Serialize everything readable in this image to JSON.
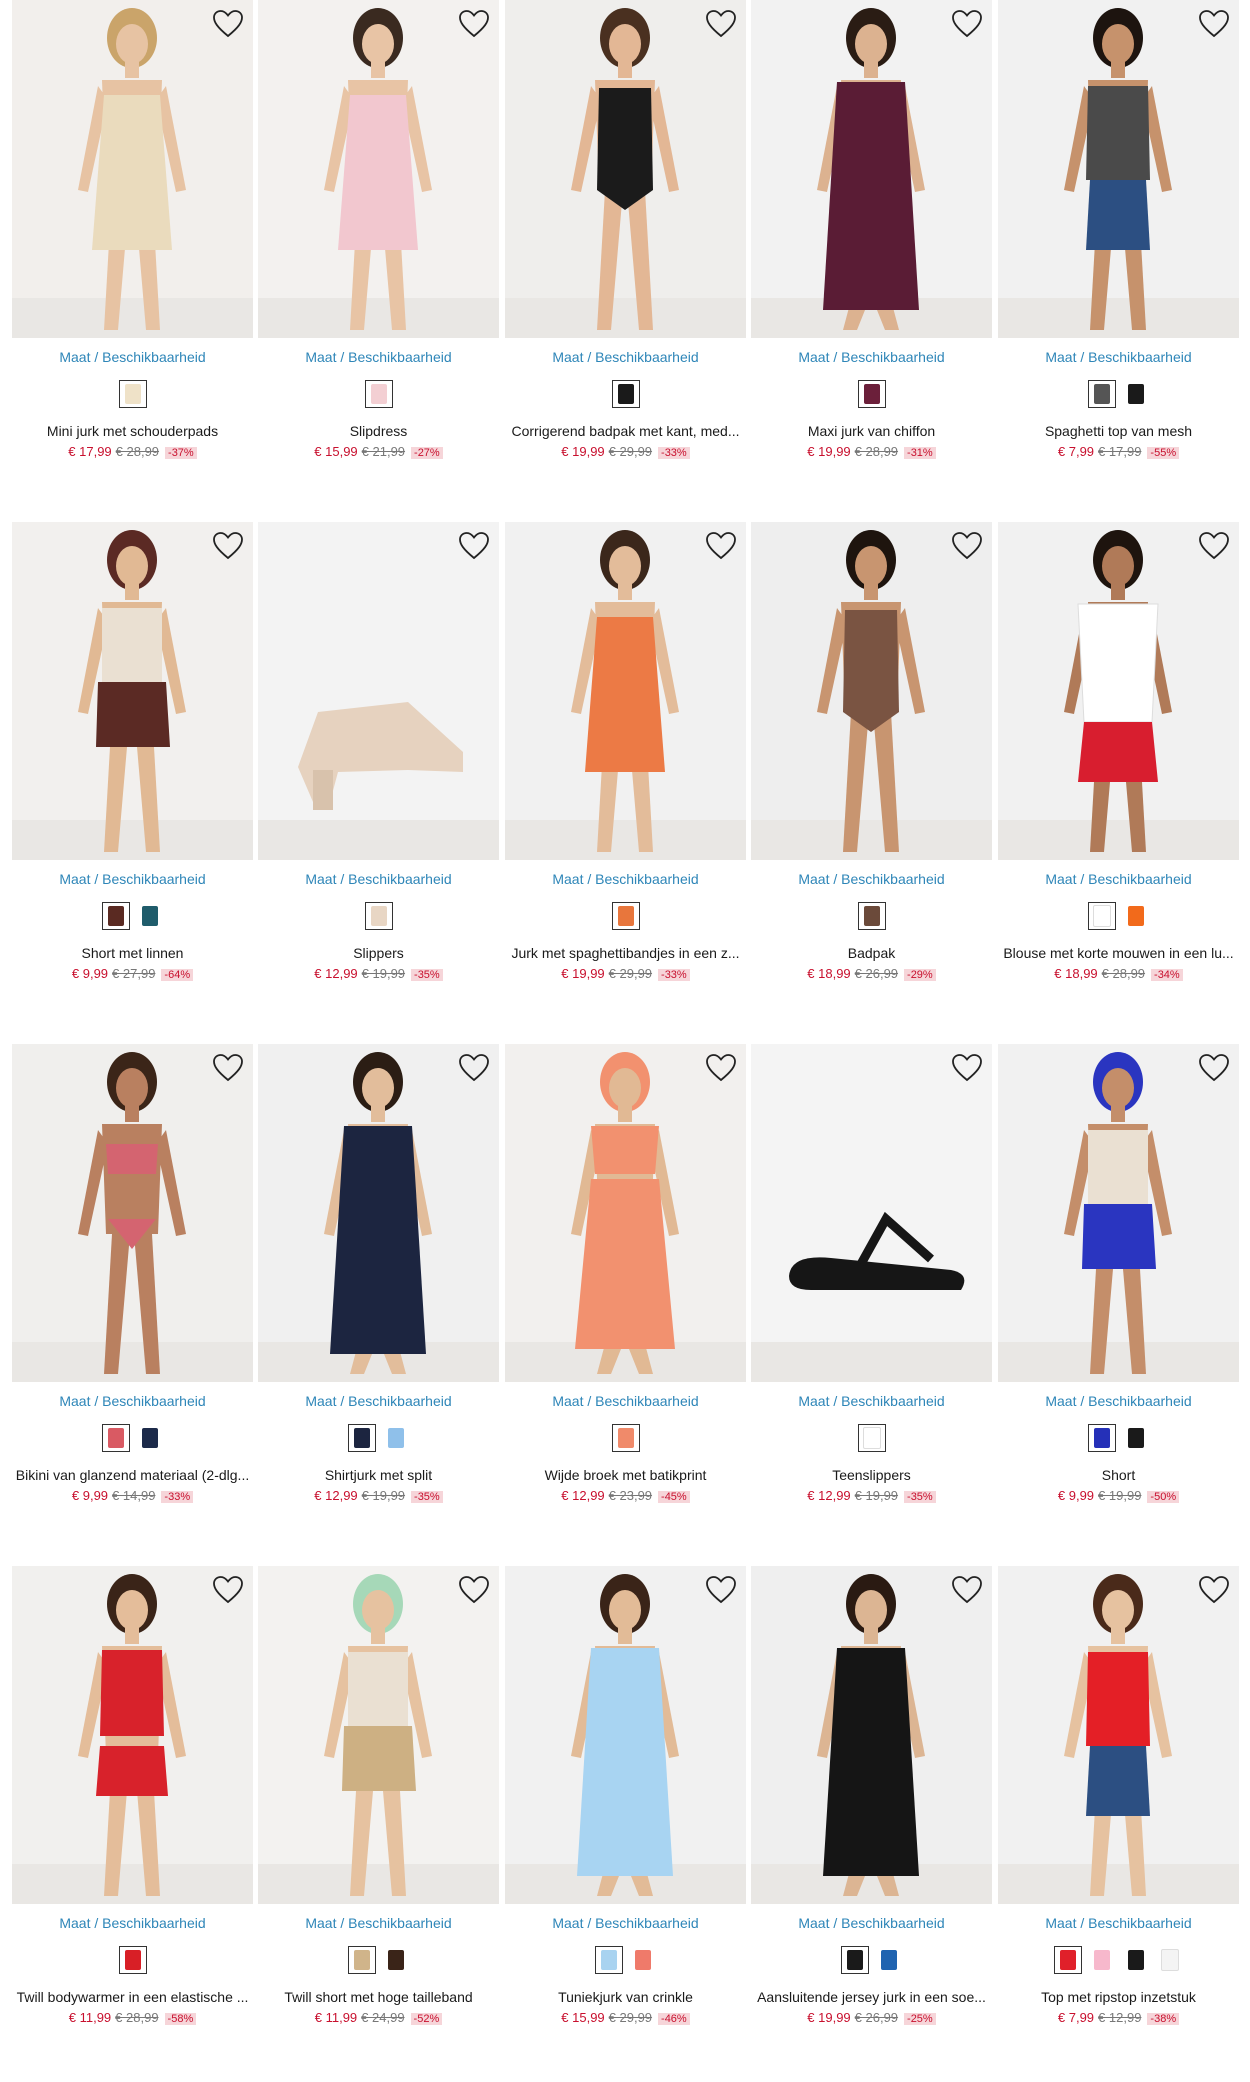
{
  "availability_label": "Maat / Beschikbaarheid",
  "colors": {
    "link": "#2e86b8",
    "sale": "#c8102e",
    "discount_bg": "#f6d5d9",
    "old_price": "#777777"
  },
  "wishlist_icon": "heart-outline-icon",
  "products": [
    {
      "title": "Mini jurk met schouderpads",
      "price": "€ 17,99",
      "old_price": "€ 28,99",
      "discount": "-37%",
      "swatches": [
        "#efe2c8"
      ],
      "image": {
        "bg": "#f2efec",
        "garment": "#eadbbd",
        "kind": "dress",
        "skin": "#e7c3a3",
        "hair": "#caa46a"
      }
    },
    {
      "title": "Slipdress",
      "price": "€ 15,99",
      "old_price": "€ 21,99",
      "discount": "-27%",
      "swatches": [
        "#f3cfd3"
      ],
      "image": {
        "bg": "#f3f1ef",
        "garment": "#f2c7cf",
        "kind": "dress",
        "skin": "#e8c4a5",
        "hair": "#3a2a20"
      }
    },
    {
      "title": "Corrigerend badpak met kant, med...",
      "price": "€ 19,99",
      "old_price": "€ 29,99",
      "discount": "-33%",
      "swatches": [
        "#1a1a1a"
      ],
      "image": {
        "bg": "#efeeec",
        "garment": "#1b1b1b",
        "kind": "swim",
        "skin": "#e3b795",
        "hair": "#4a3020"
      }
    },
    {
      "title": "Maxi jurk van chiffon",
      "price": "€ 19,99",
      "old_price": "€ 28,99",
      "discount": "-31%",
      "swatches": [
        "#6b1f3a"
      ],
      "image": {
        "bg": "#f2f2f2",
        "garment": "#5a1c35",
        "kind": "maxi",
        "skin": "#dcb290",
        "hair": "#2a1c14"
      }
    },
    {
      "title": "Spaghetti top van mesh",
      "price": "€ 7,99",
      "old_price": "€ 17,99",
      "discount": "-55%",
      "swatches": [
        "#555555",
        "#1a1a1a"
      ],
      "image": {
        "bg": "#f1f1f1",
        "garment": "#4a4a4a",
        "kind": "top",
        "skin": "#c6926c",
        "hair": "#1d140f"
      }
    },
    {
      "title": "Short met linnen",
      "price": "€ 9,99",
      "old_price": "€ 27,99",
      "discount": "-64%",
      "swatches": [
        "#5a2a22",
        "#1f5c6b"
      ],
      "image": {
        "bg": "#f2f0ee",
        "garment": "#5b2a24",
        "kind": "shorts",
        "skin": "#e1b994",
        "hair": "#5b2a24"
      }
    },
    {
      "title": "Slippers",
      "price": "€ 12,99",
      "old_price": "€ 19,99",
      "discount": "-35%",
      "swatches": [
        "#e8d6c4"
      ],
      "image": {
        "bg": "#f3f3f3",
        "garment": "#e6d2bf",
        "kind": "heel",
        "skin": "#e6d2bf",
        "hair": "#e6d2bf"
      }
    },
    {
      "title": "Jurk met spaghettibandjes in een z...",
      "price": "€ 19,99",
      "old_price": "€ 29,99",
      "discount": "-33%",
      "swatches": [
        "#e8763c"
      ],
      "image": {
        "bg": "#f1f1f1",
        "garment": "#ec7a45",
        "kind": "dress",
        "skin": "#e3bc9a",
        "hair": "#3b271b"
      }
    },
    {
      "title": "Badpak",
      "price": "€ 18,99",
      "old_price": "€ 26,99",
      "discount": "-29%",
      "swatches": [
        "#6b4a3a"
      ],
      "image": {
        "bg": "#eeeeee",
        "garment": "#7a5442",
        "kind": "swim",
        "skin": "#c89570",
        "hair": "#1e140e"
      }
    },
    {
      "title": "Blouse met korte mouwen in een lu...",
      "price": "€ 18,99",
      "old_price": "€ 28,99",
      "discount": "-34%",
      "swatches": [
        "#ffffff",
        "#f26a1b"
      ],
      "image": {
        "bg": "#f1f1f1",
        "garment": "#ffffff",
        "kind": "blouse",
        "skin": "#b07a58",
        "hair": "#1e140e"
      }
    },
    {
      "title": "Bikini van glanzend materiaal (2-dlg...",
      "price": "€ 9,99",
      "old_price": "€ 14,99",
      "discount": "-33%",
      "swatches": [
        "#d95a63",
        "#1c2a4a"
      ],
      "image": {
        "bg": "#f0efed",
        "garment": "#d46470",
        "kind": "bikini",
        "skin": "#b98060",
        "hair": "#3b2518"
      }
    },
    {
      "title": "Shirtjurk met split",
      "price": "€ 12,99",
      "old_price": "€ 19,99",
      "discount": "-35%",
      "swatches": [
        "#1c2540",
        "#8fc0ea"
      ],
      "image": {
        "bg": "#f0f0f0",
        "garment": "#1c2540",
        "kind": "maxi",
        "skin": "#e2bd9b",
        "hair": "#2b1d14"
      }
    },
    {
      "title": "Wijde broek met batikprint",
      "price": "€ 12,99",
      "old_price": "€ 23,99",
      "discount": "-45%",
      "swatches": [
        "#f08a6a"
      ],
      "image": {
        "bg": "#f2f0ee",
        "garment": "#f2916f",
        "kind": "pants",
        "skin": "#e1b994",
        "hair": "#f2916f"
      }
    },
    {
      "title": "Teenslippers",
      "price": "€ 12,99",
      "old_price": "€ 19,99",
      "discount": "-35%",
      "swatches": [
        "#ffffff"
      ],
      "image": {
        "bg": "#f4f4f4",
        "garment": "#161616",
        "kind": "sandal",
        "skin": "#161616",
        "hair": "#161616"
      }
    },
    {
      "title": "Short",
      "price": "€ 9,99",
      "old_price": "€ 19,99",
      "discount": "-50%",
      "swatches": [
        "#2530b8",
        "#1a1a1a"
      ],
      "image": {
        "bg": "#f1f1f1",
        "garment": "#2a35c0",
        "kind": "shorts",
        "skin": "#c48e6a",
        "hair": "#2a35c0"
      }
    },
    {
      "title": "Twill bodywarmer in een elastische ...",
      "price": "€ 11,99",
      "old_price": "€ 28,99",
      "discount": "-58%",
      "swatches": [
        "#d81f26"
      ],
      "image": {
        "bg": "#f1f0ee",
        "garment": "#d8222b",
        "kind": "vest",
        "skin": "#e4bd9a",
        "hair": "#3a2418"
      }
    },
    {
      "title": "Twill short met hoge tailleband",
      "price": "€ 11,99",
      "old_price": "€ 24,99",
      "discount": "-52%",
      "swatches": [
        "#d0b48a",
        "#3a2418"
      ],
      "image": {
        "bg": "#f3f2f0",
        "garment": "#cdb083",
        "kind": "shorts",
        "skin": "#e6c2a0",
        "hair": "#a6d8b8"
      }
    },
    {
      "title": "Tuniekjurk van crinkle",
      "price": "€ 15,99",
      "old_price": "€ 29,99",
      "discount": "-46%",
      "swatches": [
        "#a9d3f0",
        "#ef7a6a"
      ],
      "image": {
        "bg": "#f1f1f1",
        "garment": "#a8d4f2",
        "kind": "maxi",
        "skin": "#e2bb97",
        "hair": "#3a2418"
      }
    },
    {
      "title": "Aansluitende jersey jurk in een soe...",
      "price": "€ 19,99",
      "old_price": "€ 26,99",
      "discount": "-25%",
      "swatches": [
        "#1a1a1a",
        "#1f63b0"
      ],
      "image": {
        "bg": "#efefef",
        "garment": "#151515",
        "kind": "maxi",
        "skin": "#dcb593",
        "hair": "#2a1a12"
      }
    },
    {
      "title": "Top met ripstop inzetstuk",
      "price": "€ 7,99",
      "old_price": "€ 12,99",
      "discount": "-38%",
      "swatches": [
        "#e0202a",
        "#f7b8cc",
        "#1a1a1a",
        "#f4f4f4"
      ],
      "image": {
        "bg": "#f1f1f1",
        "garment": "#e41f26",
        "kind": "top",
        "skin": "#e6c2a0",
        "hair": "#4a2a1a"
      }
    }
  ]
}
